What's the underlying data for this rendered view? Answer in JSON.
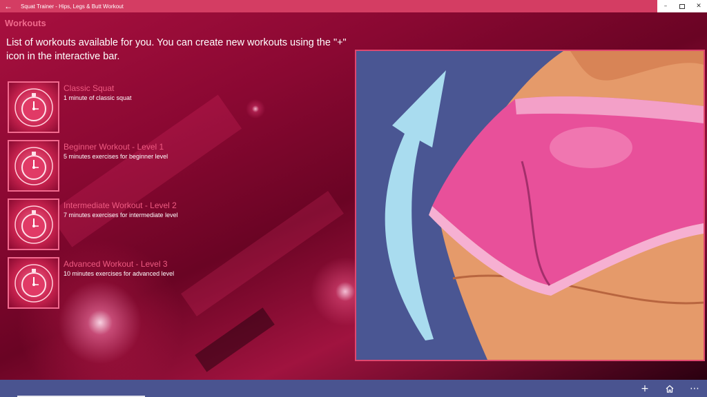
{
  "window": {
    "title": "Squat Trainer - Hips, Legs & Butt Workout",
    "back_glyph": "←",
    "minimize_glyph": "–",
    "close_glyph": "✕"
  },
  "page": {
    "title": "Workouts",
    "intro": "List of workouts available for you. You can create new workouts using the \"+\" icon in the interactive bar."
  },
  "workouts": [
    {
      "title": "Classic Squat",
      "subtitle": "1 minute of classic squat",
      "icon": "stopwatch-icon"
    },
    {
      "title": "Beginner Workout - Level 1",
      "subtitle": "5 minutes exercises for beginner level",
      "icon": "stopwatch-icon"
    },
    {
      "title": "Intermediate Workout - Level 2",
      "subtitle": "7 minutes exercises for intermediate level",
      "icon": "stopwatch-icon"
    },
    {
      "title": "Advanced Workout - Level 3",
      "subtitle": "10 minutes exercises for advanced level",
      "icon": "stopwatch-icon"
    }
  ],
  "appbar": {
    "add_glyph": "+",
    "more_glyph": "⋯"
  },
  "colors": {
    "title_bar": "#d43d63",
    "accent_text": "#ef5b82",
    "app_bar": "#4a5490",
    "hero_background": "#4a5693",
    "hero_arrow": "#a9dcef",
    "shorts": "#e8509a",
    "skin": "#e59a6a"
  }
}
